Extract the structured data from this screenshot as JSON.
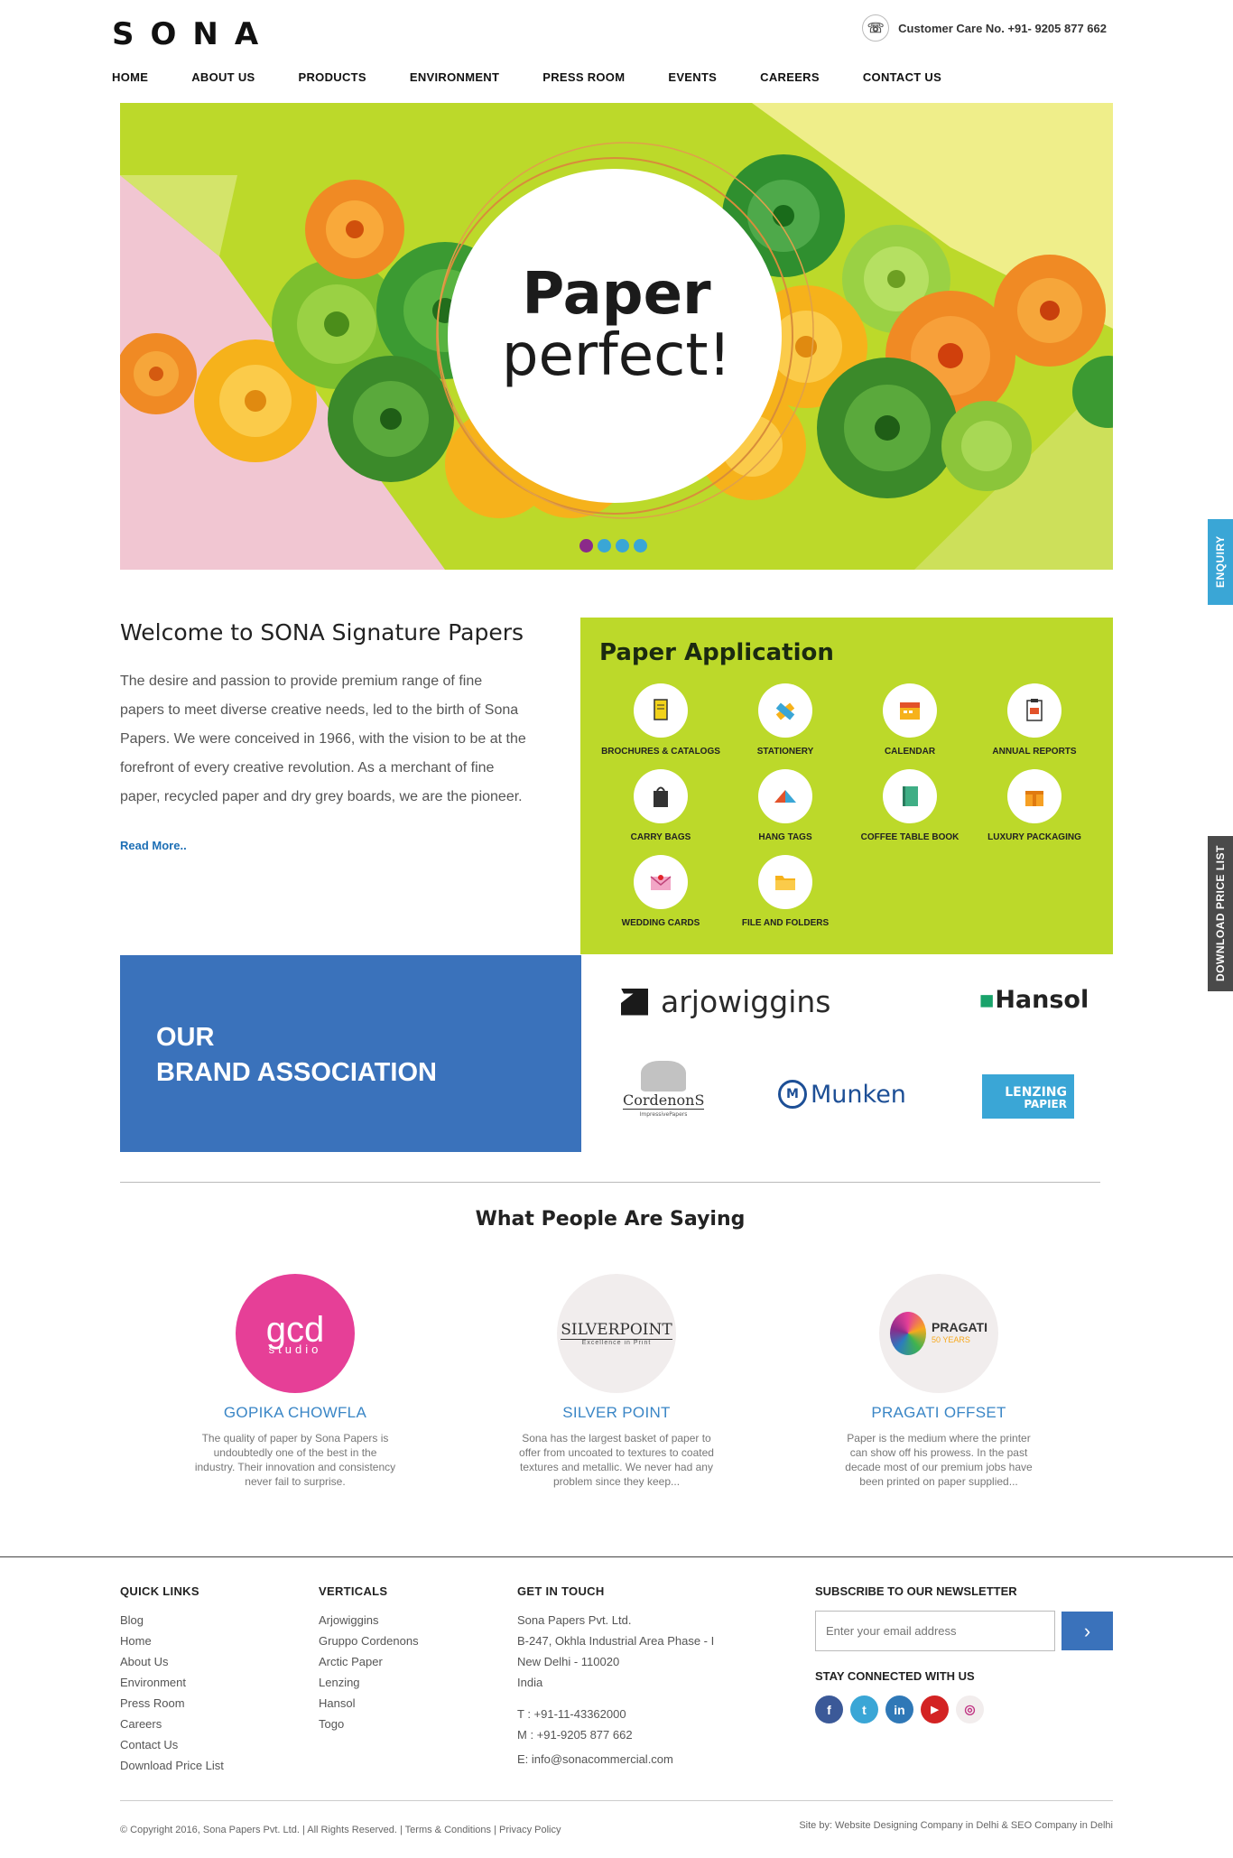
{
  "header": {
    "logo": "SONA",
    "customer_care": "Customer Care No. +91- 9205 877 662"
  },
  "nav": [
    "HOME",
    "ABOUT US",
    "PRODUCTS",
    "ENVIRONMENT",
    "PRESS ROOM",
    "EVENTS",
    "CAREERS",
    "CONTACT US"
  ],
  "hero": {
    "line1": "Paper",
    "line2": "perfect!",
    "slides": 4,
    "active_slide": 1
  },
  "side_tabs": {
    "enquiry": "ENQUIRY",
    "price_list": "DOWNLOAD PRICE LIST"
  },
  "welcome": {
    "title": "Welcome to SONA Signature Papers",
    "body": "The desire and passion to provide premium range of fine papers to meet diverse creative needs, led to the birth of Sona Papers. We were conceived in 1966, with the vision to be at the forefront of every creative revolution. As a merchant of fine paper, recycled paper and dry grey boards, we are the pioneer.",
    "read_more": "Read More.."
  },
  "paper_application": {
    "title": "Paper Application",
    "items": [
      {
        "label": "BROCHURES & CATALOGS",
        "icon": "brochure-icon"
      },
      {
        "label": "STATIONERY",
        "icon": "stationery-icon"
      },
      {
        "label": "CALENDAR",
        "icon": "calendar-icon"
      },
      {
        "label": "ANNUAL REPORTS",
        "icon": "annual-report-icon"
      },
      {
        "label": "CARRY BAGS",
        "icon": "carry-bag-icon"
      },
      {
        "label": "HANG TAGS",
        "icon": "hang-tag-icon"
      },
      {
        "label": "COFFEE TABLE BOOK",
        "icon": "book-icon"
      },
      {
        "label": "LUXURY PACKAGING",
        "icon": "gift-box-icon"
      },
      {
        "label": "WEDDING CARDS",
        "icon": "wedding-card-icon"
      },
      {
        "label": "FILE AND FOLDERS",
        "icon": "folder-icon"
      }
    ]
  },
  "brands": {
    "title_line1": "OUR",
    "title_line2": "BRAND ASSOCIATION",
    "arjowiggins": "arjowiggins",
    "hansol": "Hansol",
    "cordenons": "CordenonS",
    "cordenons_sub": "ImpressivePapers",
    "munken": "Munken",
    "lenzing": "LENZING",
    "lenzing_sub": "PAPIER"
  },
  "testimonials": {
    "title": "What People Are Saying",
    "items": [
      {
        "logo": "gcd",
        "logo_sub": "studio",
        "name": "GOPIKA CHOWFLA",
        "text": "The quality of paper by Sona Papers is undoubtedly one of the best in the industry. Their innovation and consistency never fail to surprise."
      },
      {
        "logo": "SILVERPOINT",
        "logo_sub": "Excellence in Print",
        "name": "SILVER POINT",
        "text": "Sona has the largest basket of paper to offer from uncoated to textures to coated textures and metallic. We never had any problem since they keep..."
      },
      {
        "logo": "PRAGATI",
        "logo_sub": "50 YEARS",
        "name": "PRAGATI OFFSET",
        "text": "Paper is the medium where the printer can show off his prowess. In the past decade most of our premium jobs have been printed on paper supplied..."
      }
    ]
  },
  "footer": {
    "quick_links": {
      "title": "QUICK LINKS",
      "items": [
        "Blog",
        "Home",
        "About Us",
        "Environment",
        "Press Room",
        "Careers",
        "Contact Us",
        "Download Price List"
      ]
    },
    "verticals": {
      "title": "VERTICALS",
      "items": [
        "Arjowiggins",
        "Gruppo Cordenons",
        "Arctic Paper",
        "Lenzing",
        "Hansol",
        "Togo"
      ]
    },
    "contact": {
      "title": "GET IN TOUCH",
      "company": "Sona Papers Pvt. Ltd.",
      "addr1": "B-247, Okhla Industrial Area Phase - I",
      "addr2": "New Delhi - 110020",
      "country": "India",
      "tel": "T : +91-11-43362000",
      "mobile": "M : +91-9205 877 662",
      "email": "E: info@sonacommercial.com"
    },
    "newsletter": {
      "title": "SUBSCRIBE TO OUR NEWSLETTER",
      "placeholder": "Enter your email address",
      "stay": "STAY CONNECTED WITH US"
    },
    "social": [
      {
        "name": "facebook-icon",
        "glyph": "f",
        "color": "#3b5998"
      },
      {
        "name": "twitter-icon",
        "glyph": "t",
        "color": "#3aa6d6"
      },
      {
        "name": "linkedin-icon",
        "glyph": "in",
        "color": "#2f78b7"
      },
      {
        "name": "youtube-icon",
        "glyph": "▶",
        "color": "#d32323"
      },
      {
        "name": "instagram-icon",
        "glyph": "◎",
        "color": "#f2eded"
      }
    ],
    "copyright": "© Copyright 2016, Sona Papers Pvt. Ltd. | All Rights Reserved. |",
    "terms": "Terms & Conditions",
    "privacy": "Privacy Policy",
    "site_by": "Site by: Website Designing Company in Delhi & SEO Company in Delhi"
  },
  "colors": {
    "lime": "#bcd92a",
    "brand_blue": "#3a72bb",
    "link_blue": "#3a86c6",
    "accent_cyan": "#3aa6d6"
  }
}
